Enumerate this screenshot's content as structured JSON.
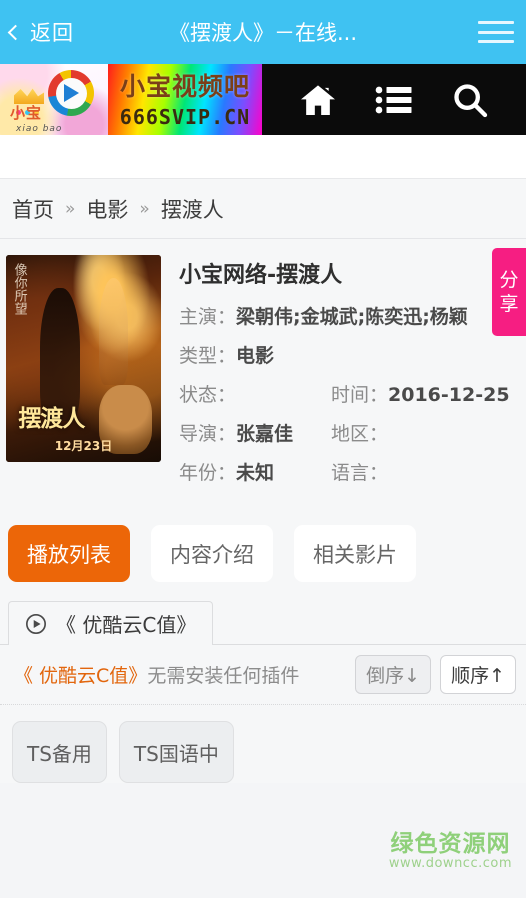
{
  "topbar": {
    "back_label": "返回",
    "title": "《摆渡人》－在线...",
    "menu_icon": "hamburger-icon",
    "bg_color": "#3fc2f2"
  },
  "banner": {
    "logo_name": "小宝",
    "logo_sub": "xiao bao",
    "line1": "小宝视频吧",
    "line2": "666SVIP.CN",
    "icons": [
      "home-icon",
      "list-icon",
      "search-icon"
    ]
  },
  "breadcrumb": {
    "items": [
      "首页",
      "电影",
      "摆渡人"
    ],
    "separator": "»"
  },
  "share": {
    "label_line1": "分",
    "label_line2": "享",
    "color": "#f61e82"
  },
  "movie": {
    "poster_title": "摆渡人",
    "poster_date": "12月23日",
    "poster_side_text": "像你所望",
    "title": "小宝网络-摆渡人",
    "fields": [
      {
        "label": "主演：",
        "value": "梁朝伟;金城武;陈奕迅;杨颖"
      },
      {
        "label": "类型：",
        "value": "电影"
      }
    ],
    "pairs": [
      {
        "label_a": "状态：",
        "value_a": "",
        "label_b": "时间：",
        "value_b": "2016-12-25"
      },
      {
        "label_a": "导演：",
        "value_a": "张嘉佳",
        "label_b": "地区：",
        "value_b": ""
      },
      {
        "label_a": "年份：",
        "value_a": "未知",
        "label_b": "语言：",
        "value_b": ""
      }
    ]
  },
  "tabs": [
    {
      "label": "播放列表",
      "active": true
    },
    {
      "label": "内容介绍",
      "active": false
    },
    {
      "label": "相关影片",
      "active": false
    }
  ],
  "source_tab": {
    "label": "《 优酷云C值》",
    "icon": "play-circle-icon"
  },
  "notice": {
    "highlight": "《 优酷云C值》",
    "text": "无需安装任何插件",
    "sort_desc": "倒序↓",
    "sort_asc": "顺序↑"
  },
  "episodes": [
    {
      "label": "TS备用"
    },
    {
      "label": "TS国语中"
    }
  ],
  "watermark": {
    "line1": "绿色资源网",
    "line2": "www.downcc.com"
  }
}
